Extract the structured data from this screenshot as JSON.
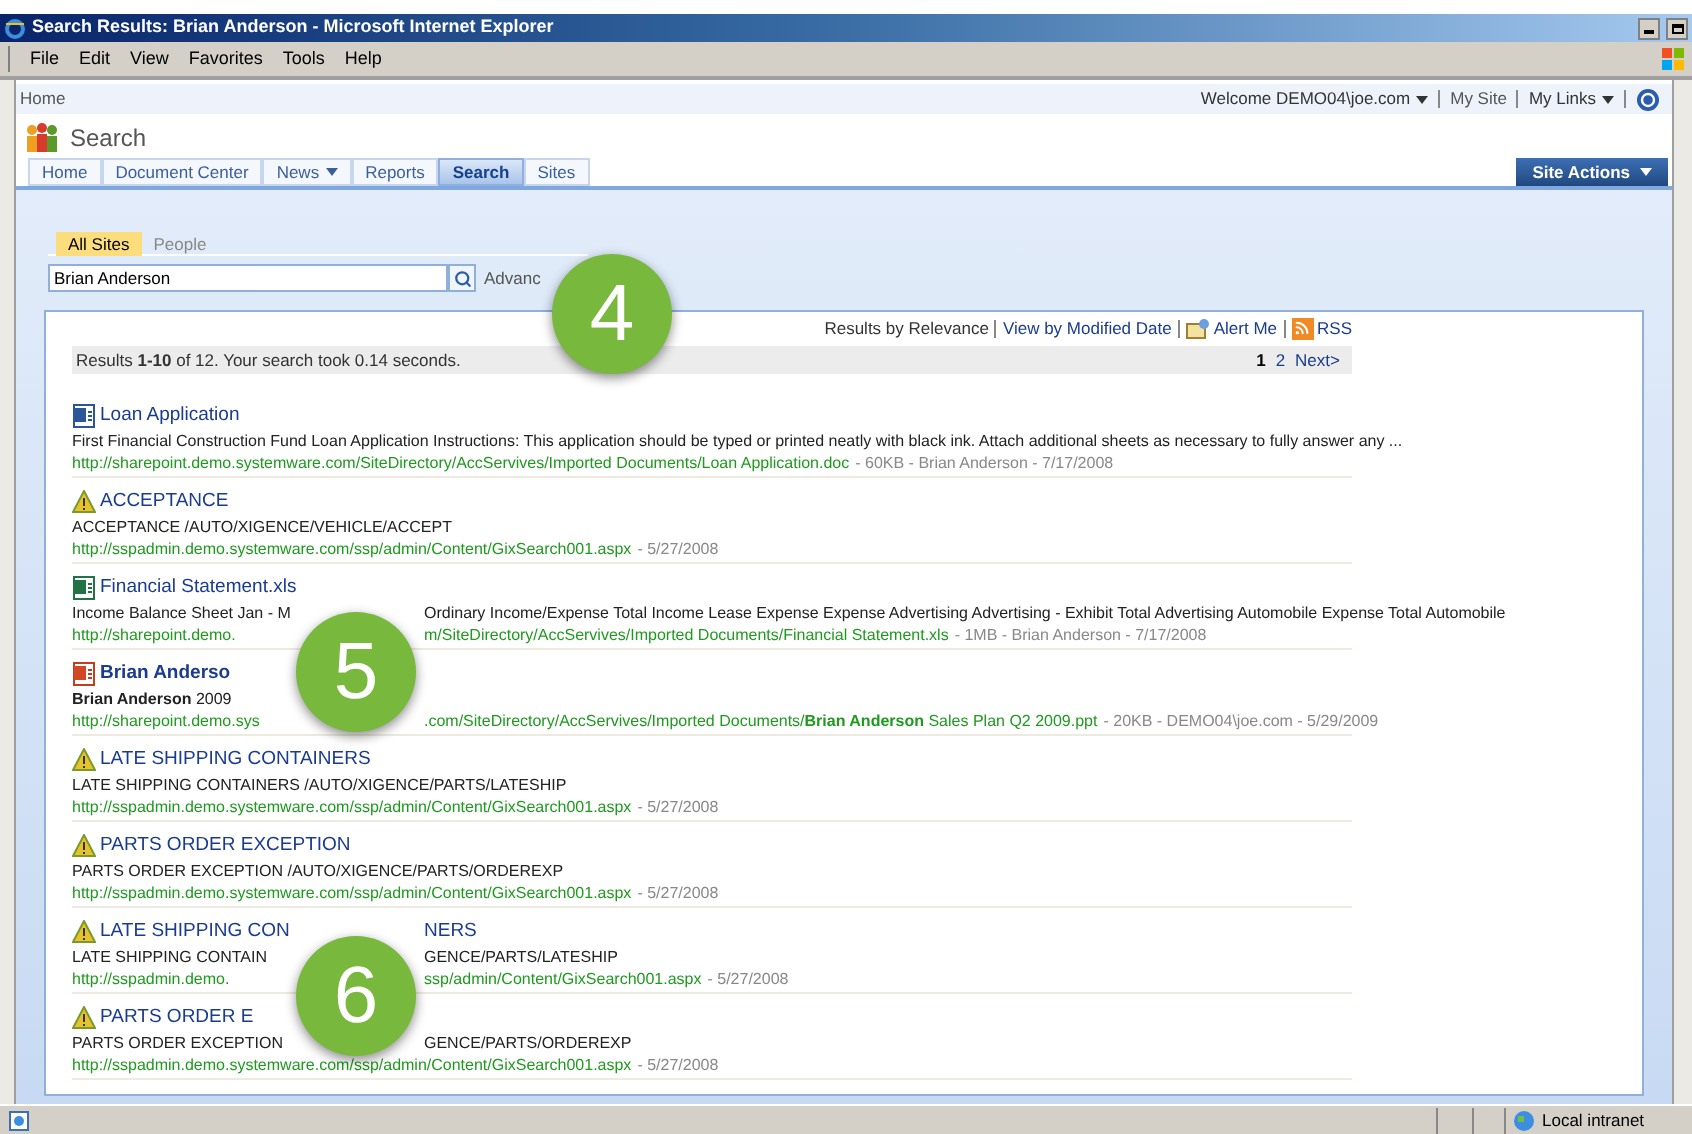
{
  "window": {
    "title": "Search Results: Brian Anderson - Microsoft Internet Explorer"
  },
  "menu": [
    "File",
    "Edit",
    "View",
    "Favorites",
    "Tools",
    "Help"
  ],
  "top_links": {
    "breadcrumb": "Home",
    "welcome": "Welcome DEMO04\\joe.com",
    "my_site": "My Site",
    "my_links": "My Links"
  },
  "site_title": "Search",
  "nav_tabs": [
    {
      "label": "Home",
      "selected": false,
      "dropdown": false
    },
    {
      "label": "Document Center",
      "selected": false,
      "dropdown": false
    },
    {
      "label": "News",
      "selected": false,
      "dropdown": true
    },
    {
      "label": "Reports",
      "selected": false,
      "dropdown": false
    },
    {
      "label": "Search",
      "selected": true,
      "dropdown": false
    },
    {
      "label": "Sites",
      "selected": false,
      "dropdown": false
    }
  ],
  "site_actions": "Site Actions",
  "scope_tabs": [
    {
      "label": "All Sites",
      "selected": true
    },
    {
      "label": "People",
      "selected": false
    }
  ],
  "search": {
    "value": "Brian Anderson",
    "advanced_link": "Advanc"
  },
  "results_header": {
    "sort_current": "Results by Relevance",
    "sort_link": "View by Modified Date",
    "alert": "Alert Me",
    "rss": "RSS"
  },
  "summary": "Results **1-10** of 12. Your search took 0.14 seconds.",
  "pages": [
    {
      "label": "1",
      "selected": true
    },
    {
      "label": "2",
      "selected": false
    },
    {
      "label": "Next>",
      "selected": false
    }
  ],
  "results": [
    {
      "kind": "doc",
      "title": [
        "Loan Application"
      ],
      "snippet": [
        "First Financial Construction Fund Loan Application Instructions: This application should be typed or printed neatly with black ink. Attach additional sheets as necessary to fully answer any ..."
      ],
      "url": [
        "http://sharepoint.demo.systemware.com/SiteDirectory/AccServives/Imported Documents/Loan Application.doc"
      ],
      "meta": "- 60KB - Brian Anderson - 7/17/2008"
    },
    {
      "kind": "alert",
      "title": [
        "ACCEPTANCE"
      ],
      "snippet": [
        "ACCEPTANCE /AUTO/XIGENCE/VEHICLE/ACCEPT"
      ],
      "url": [
        "http://sspadmin.demo.systemware.com/ssp/admin/Content/GixSearch001.aspx"
      ],
      "meta": "- 5/27/2008"
    },
    {
      "kind": "xls",
      "title": [
        "Financial Statement.xls"
      ],
      "snippet": [
        "Income Balance Sheet Jan - M",
        "Ordinary Income/Expense Total Income Lease Expense Expense Advertising Advertising - Exhibit Total Advertising Automobile Expense Total Automobile"
      ],
      "url": [
        "http://sharepoint.demo.",
        "m/SiteDirectory/AccServives/Imported Documents/Financial Statement.xls"
      ],
      "meta": "- 1MB - Brian Anderson - 7/17/2008"
    },
    {
      "kind": "ppt",
      "title": [
        "Brian Anderso"
      ],
      "snippet": [
        "**Brian Anderson** 2009"
      ],
      "url": [
        "http://sharepoint.demo.sys",
        ".com/SiteDirectory/AccServives/Imported Documents/**Brian Anderson** Sales Plan Q2 2009.ppt"
      ],
      "meta": "- 20KB - DEMO04\\joe.com - 5/29/2009"
    },
    {
      "kind": "alert",
      "title": [
        "LATE SHIPPING CONTAINERS"
      ],
      "snippet": [
        "LATE SHIPPING CONTAINERS /AUTO/XIGENCE/PARTS/LATESHIP"
      ],
      "url": [
        "http://sspadmin.demo.systemware.com/ssp/admin/Content/GixSearch001.aspx"
      ],
      "meta": "- 5/27/2008"
    },
    {
      "kind": "alert",
      "title": [
        "PARTS ORDER EXCEPTION"
      ],
      "snippet": [
        "PARTS ORDER EXCEPTION /AUTO/XIGENCE/PARTS/ORDEREXP"
      ],
      "url": [
        "http://sspadmin.demo.systemware.com/ssp/admin/Content/GixSearch001.aspx"
      ],
      "meta": "- 5/27/2008"
    },
    {
      "kind": "alert",
      "title": [
        "LATE SHIPPING CON",
        "NERS"
      ],
      "snippet": [
        "LATE SHIPPING CONTAIN",
        "GENCE/PARTS/LATESHIP"
      ],
      "url": [
        "http://sspadmin.demo.",
        "ssp/admin/Content/GixSearch001.aspx"
      ],
      "meta": "- 5/27/2008"
    },
    {
      "kind": "alert",
      "title": [
        "PARTS ORDER E"
      ],
      "snippet": [
        "PARTS ORDER EXCEPTION",
        "GENCE/PARTS/ORDEREXP"
      ],
      "url": [
        "http://sspadmin.demo.systemware.com/ssp/admin/Content/GixSearch001.aspx"
      ],
      "meta": "- 5/27/2008"
    }
  ],
  "callouts": [
    {
      "label": "4"
    },
    {
      "label": "5"
    },
    {
      "label": "6"
    }
  ],
  "status_bar": {
    "zone": "Local intranet"
  }
}
